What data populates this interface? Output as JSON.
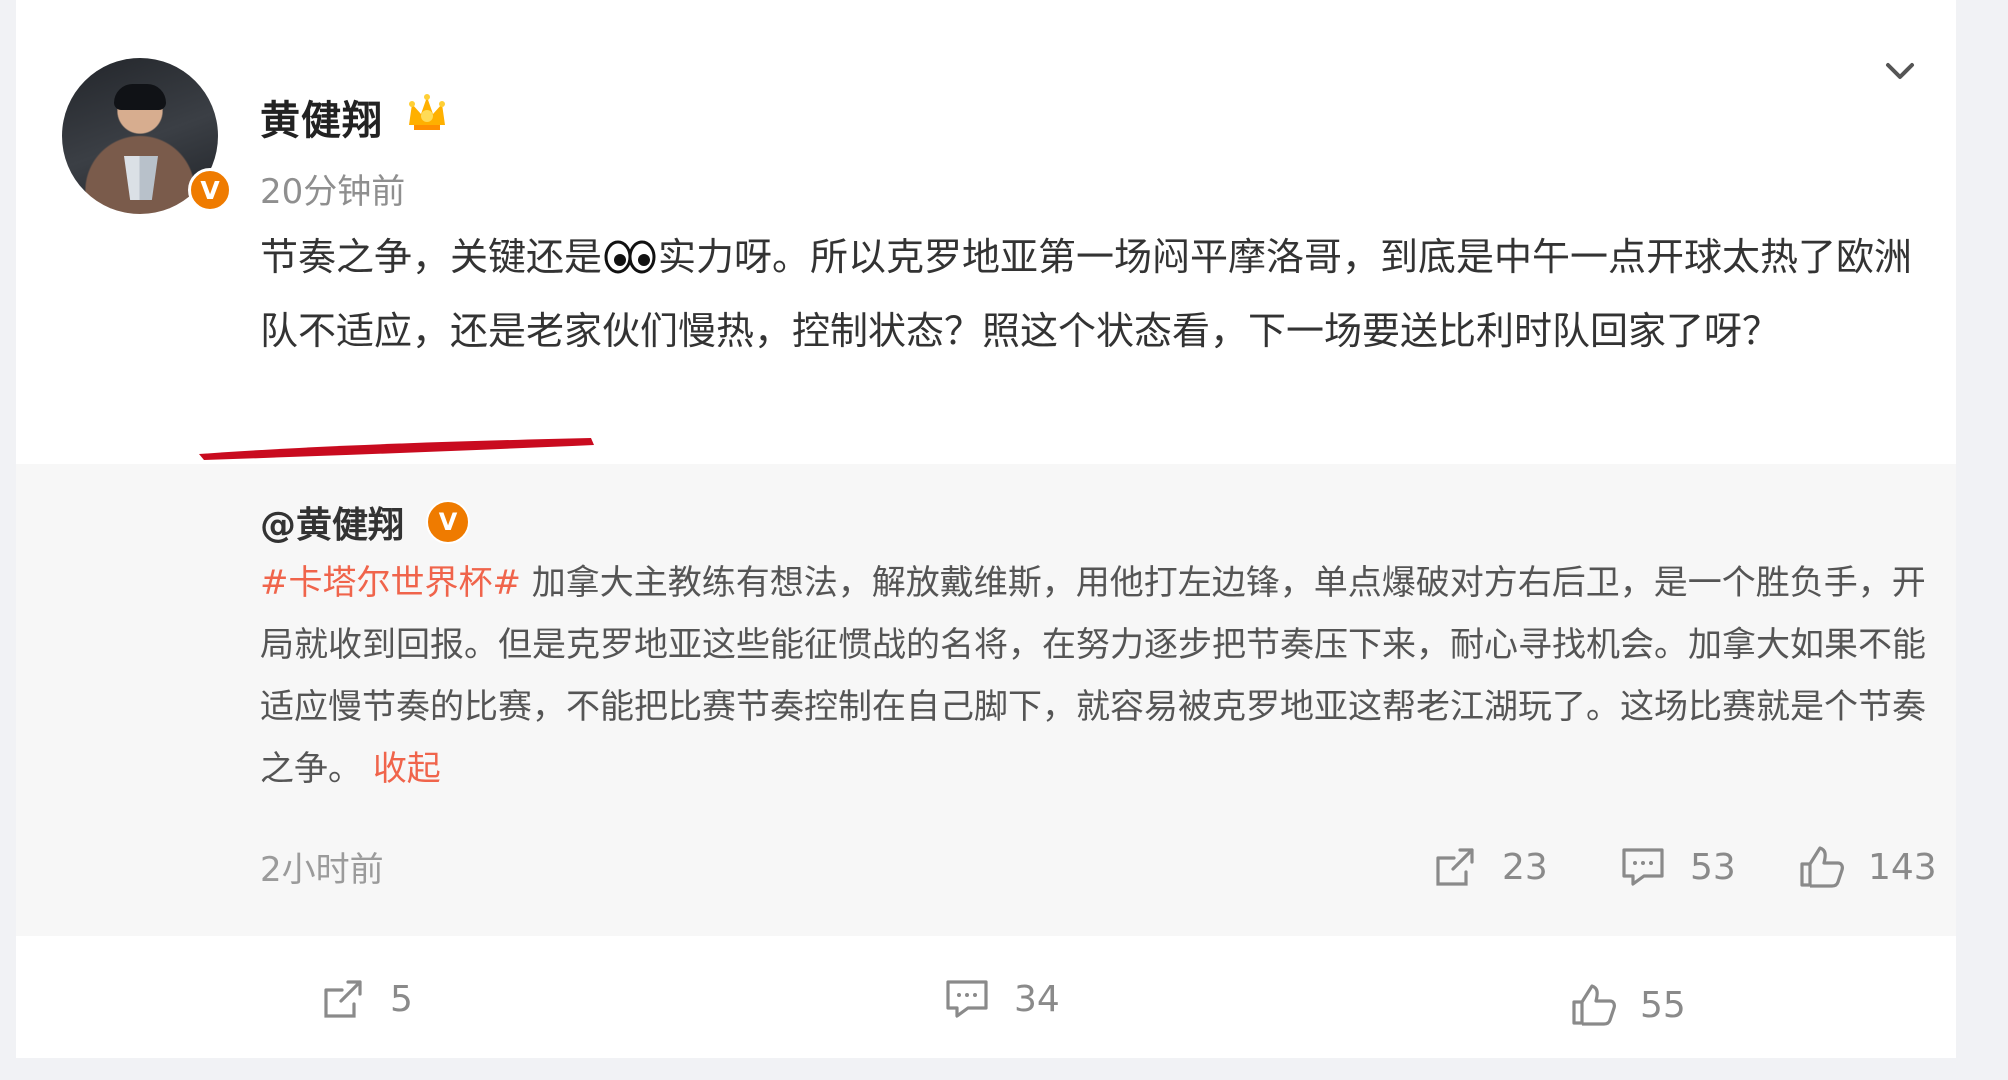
{
  "post": {
    "author": "黄健翔",
    "time": "20分钟前",
    "text_before_emoji": "节奏之争，关键还是",
    "text_after_emoji": "实力呀。所以克罗地亚第一场闷平摩洛哥，到底是中午一点开球太热了欧洲队不适应，还是老家伙们慢热，控制状态？照这个状态看，下一场要送比利时队回家了呀？",
    "avatar_icon": "person-avatar-icon",
    "verified_badge": "V",
    "crown_icon": "crown-icon",
    "eyes_emoji_icon": "eyes-emoji-icon",
    "dropdown_icon": "chevron-down-icon"
  },
  "quoted_post": {
    "author": "@黄健翔",
    "verified_badge": "V",
    "topic": "#卡塔尔世界杯#",
    "text": " 加拿大主教练有想法，解放戴维斯，用他打左边锋，单点爆破对方右后卫，是一个胜负手，开局就收到回报。但是克罗地亚这些能征惯战的名将，在努力逐步把节奏压下来，耐心寻找机会。加拿大如果不能适应慢节奏的比赛，不能把比赛节奏控制在自己脚下，就容易被克罗地亚这帮老江湖玩了。这场比赛就是个节奏之争。",
    "collapse_label": "收起",
    "time": "2小时前",
    "stats": {
      "repost": "23",
      "comment": "53",
      "like": "143"
    }
  },
  "bottom_actions": {
    "repost": "5",
    "comment": "34",
    "like": "55"
  },
  "colors": {
    "accent": "#f0644b",
    "verified": "#ef7b00",
    "underline": "#c90b1f",
    "background": "#f1f2f5"
  }
}
